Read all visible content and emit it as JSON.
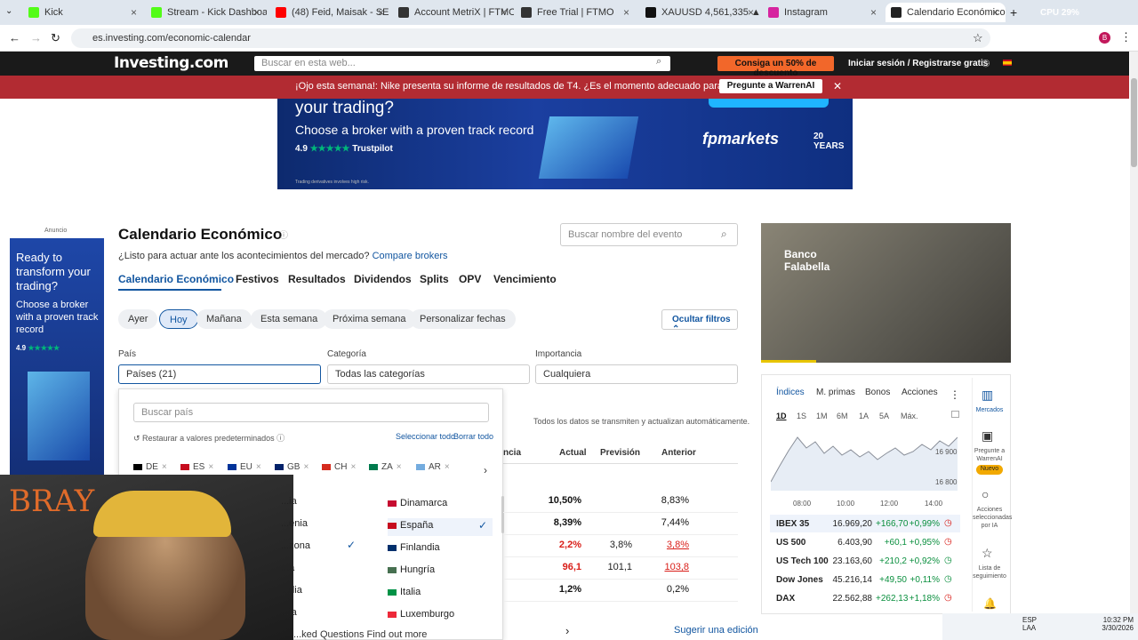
{
  "browser": {
    "tabs": [
      {
        "title": "Kick",
        "color": "#53fc18"
      },
      {
        "title": "Stream - Kick Dashboard",
        "color": "#53fc18"
      },
      {
        "title": "(48) Feid, Maisak - SE",
        "color": "#ff0000"
      },
      {
        "title": "Account MetriX | FTMO",
        "color": "#333333"
      },
      {
        "title": "Free Trial | FTMO",
        "color": "#333333"
      },
      {
        "title": "XAUUSD 4,561,335 ▲ +1.",
        "color": "#111111"
      },
      {
        "title": "Instagram",
        "color": "#d6249f"
      },
      {
        "title": "Calendario Económico | ",
        "color": "#222222"
      }
    ],
    "url": "es.investing.com/economic-calendar",
    "perf": "CPU 29%"
  },
  "header": {
    "logo": "Investing.com",
    "search_placeholder": "Buscar en esta web...",
    "promo": "Consiga un 50% de descuento",
    "login": "Iniciar sesión",
    "register": "Registrarse gratis"
  },
  "alert": {
    "text": "¡Ojo esta semana!: Nike presenta su informe de resultados de T4. ¿Es el momento adecuado para comprar?",
    "button": "Pregunte a WarrenAI"
  },
  "ad_top": {
    "line1": "your trading?",
    "line2": "Choose a broker with a proven track record",
    "rating": "4.9",
    "trust": "Trustpilot",
    "brand": "fpmarkets",
    "years": "20 YEARS",
    "disclaimer": "Trading derivatives involves high risk."
  },
  "ad_left": {
    "label": "Anuncio",
    "text": "Ready to transform your trading?",
    "sub": "Choose a broker with a proven track record",
    "rating": "4.9"
  },
  "page": {
    "title": "Calendario Económico",
    "subtitle": "¿Listo para actuar ante los acontecimientos del mercado?",
    "compare": "Compare brokers",
    "event_search": "Buscar nombre del evento",
    "nav": [
      "Calendario Económico",
      "Festivos",
      "Resultados",
      "Dividendos",
      "Splits",
      "OPV",
      "Vencimiento"
    ],
    "periods": [
      "Ayer",
      "Hoy",
      "Mañana",
      "Esta semana",
      "Próxima semana",
      "Personalizar fechas"
    ],
    "hide_filters": "Ocultar filtros",
    "filters": {
      "country_label": "País",
      "country_value": "Países (21)",
      "category_label": "Categoría",
      "category_value": "Todas las categorías",
      "importance_label": "Importancia",
      "importance_value": "Cualquiera"
    },
    "realtime_note": "Todos los datos se transmiten y actualizan automáticamente.",
    "columns": [
      "Actual",
      "Previsión",
      "Anterior"
    ],
    "col_partial": "ncia",
    "rows": [
      {
        "actual": "10,50%",
        "forecast": "",
        "previous": "8,83%",
        "actual_color": "#111111",
        "prev_color": "#111111"
      },
      {
        "actual": "8,39%",
        "forecast": "",
        "previous": "7,44%",
        "actual_color": "#111111",
        "prev_color": "#111111"
      },
      {
        "actual": "2,2%",
        "forecast": "3,8%",
        "previous": "3,8%",
        "actual_color": "#d91e18",
        "prev_color": "#d91e18"
      },
      {
        "actual": "96,1",
        "forecast": "101,1",
        "previous": "103,8",
        "actual_color": "#d91e18",
        "prev_color": "#d91e18"
      },
      {
        "actual": "1,2%",
        "forecast": "",
        "previous": "0,2%",
        "actual_color": "#111111",
        "prev_color": "#111111"
      }
    ],
    "faq": "...ked Questions Find out more",
    "suggest": "Sugerir una edición"
  },
  "country_dropdown": {
    "search_placeholder": "Buscar país",
    "restore": "Restaurar a valores predeterminados",
    "select_all": "Seleccionar todo",
    "clear_all": "Borrar todo",
    "chips": [
      "DE",
      "ES",
      "EU",
      "GB",
      "CH",
      "ZA",
      "AR"
    ],
    "left_list": [
      "...ia",
      "...enia",
      "...zona",
      "...a",
      "...dia",
      "...ia"
    ],
    "right_list": [
      {
        "name": "Dinamarca",
        "checked": false
      },
      {
        "name": "España",
        "checked": true
      },
      {
        "name": "Finlandia",
        "checked": false
      },
      {
        "name": "Hungría",
        "checked": false
      },
      {
        "name": "Italia",
        "checked": false
      },
      {
        "name": "Luxemburgo",
        "checked": false
      }
    ]
  },
  "sidebar": {
    "ad_brand": "Banco Falabella",
    "tabs": [
      "Índices",
      "M. primas",
      "Bonos",
      "Acciones"
    ],
    "ranges": [
      "1D",
      "1S",
      "1M",
      "6M",
      "1A",
      "5A",
      "Máx."
    ],
    "chart_times": [
      "08:00",
      "10:00",
      "12:00",
      "14:00"
    ],
    "chart_prices": [
      "16 900",
      "16 800"
    ],
    "indices": [
      {
        "name": "IBEX 35",
        "price": "16.969,20",
        "chg": "+166,70",
        "pct": "+0,99%"
      },
      {
        "name": "US 500",
        "price": "6.403,90",
        "chg": "+60,1",
        "pct": "+0,95%"
      },
      {
        "name": "US Tech 100",
        "price": "23.163,60",
        "chg": "+210,2",
        "pct": "+0,92%"
      },
      {
        "name": "Dow Jones",
        "price": "45.216,14",
        "chg": "+49,50",
        "pct": "+0,11%"
      },
      {
        "name": "DAX",
        "price": "22.562,88",
        "chg": "+262,13",
        "pct": "+1,18%"
      }
    ],
    "right_menu": [
      "Mercados",
      "Pregunte a WarrenAI",
      "Nuevo",
      "Acciones seleccionadas por IA",
      "Lista de seguimiento"
    ]
  },
  "webcam": {
    "overlay": "BRAY"
  },
  "taskbar": {
    "lang1": "ESP",
    "lang2": "LAA",
    "time": "10:32 PM",
    "date": "3/30/2026"
  }
}
